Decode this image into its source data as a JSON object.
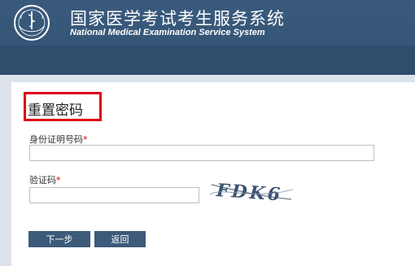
{
  "header": {
    "title_cn": "国家医学考试考生服务系统",
    "title_en": "National Medical Examination Service System"
  },
  "form": {
    "heading": "重置密码",
    "id_label": "身份证明号码",
    "id_value": "",
    "captcha_label": "验证码",
    "captcha_value": "",
    "required_mark": "*",
    "captcha_text": "FDK6"
  },
  "buttons": {
    "next_label": "下一步",
    "back_label": "返回"
  },
  "colors": {
    "header_bg": "#3a5a7d",
    "nav_bg": "#2f4d6d",
    "button_bg": "#3d5a7a",
    "highlight_border": "#e0001b",
    "required": "#d40000"
  }
}
